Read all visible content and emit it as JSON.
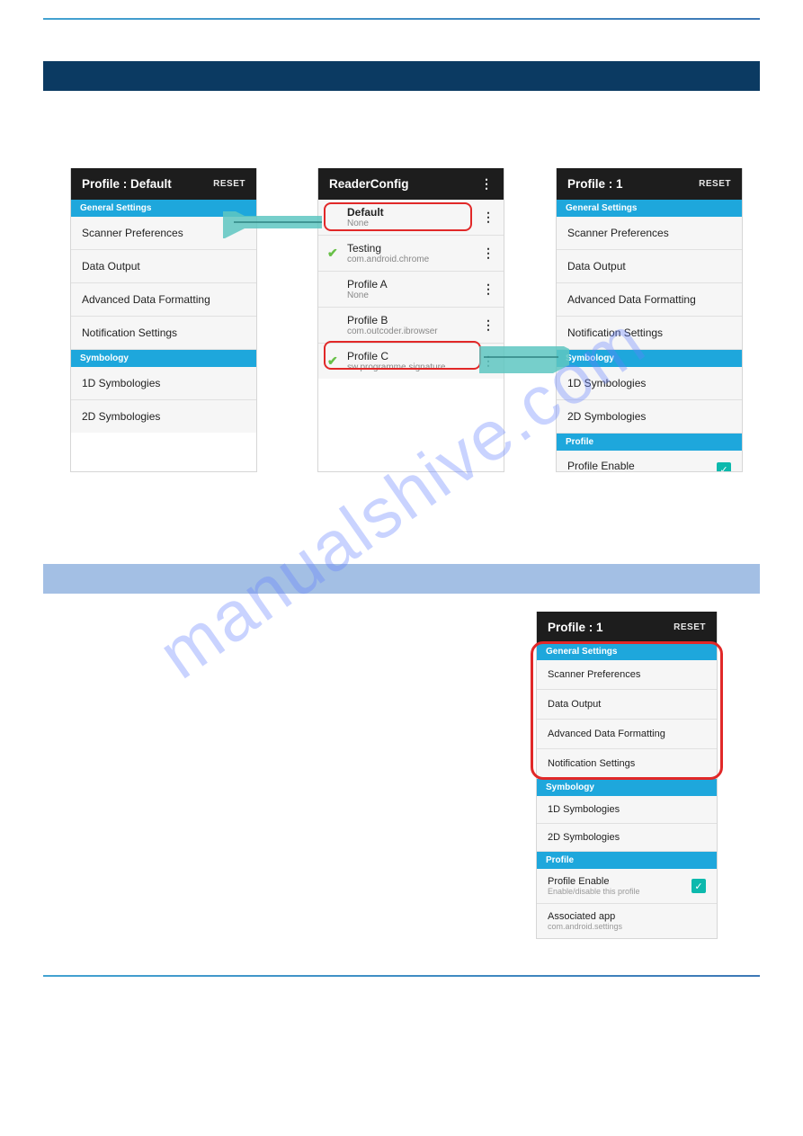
{
  "watermark": "manualshive.com",
  "panel_a": {
    "title": "Profile : Default",
    "reset": "RESET",
    "section1": "General Settings",
    "items1": [
      "Scanner Preferences",
      "Data Output",
      "Advanced Data Formatting",
      "Notification Settings"
    ],
    "section2": "Symbology",
    "items2": [
      "1D Symbologies",
      "2D Symbologies"
    ]
  },
  "panel_b": {
    "title": "ReaderConfig",
    "rows": [
      {
        "title": "Default",
        "sub": "None",
        "bold": true,
        "check": false
      },
      {
        "title": "Testing",
        "sub": "com.android.chrome",
        "bold": false,
        "check": true
      },
      {
        "title": "Profile A",
        "sub": "None",
        "bold": false,
        "check": false
      },
      {
        "title": "Profile B",
        "sub": "com.outcoder.ibrowser",
        "bold": false,
        "check": false
      },
      {
        "title": "Profile C",
        "sub": "sw.programme.signature",
        "bold": false,
        "check": true
      }
    ]
  },
  "panel_c": {
    "title": "Profile : 1",
    "reset": "RESET",
    "section1": "General Settings",
    "items1": [
      "Scanner Preferences",
      "Data Output",
      "Advanced Data Formatting",
      "Notification Settings"
    ],
    "section2": "Symbology",
    "items2": [
      "1D Symbologies",
      "2D Symbologies"
    ],
    "section3": "Profile",
    "items3": [
      "Profile Enable"
    ]
  },
  "panel_d": {
    "title": "Profile : 1",
    "reset": "RESET",
    "section1": "General Settings",
    "items1": [
      "Scanner Preferences",
      "Data Output",
      "Advanced Data Formatting",
      "Notification Settings"
    ],
    "section2": "Symbology",
    "items2": [
      "1D Symbologies",
      "2D Symbologies"
    ],
    "section3": "Profile",
    "profile_enable_title": "Profile Enable",
    "profile_enable_sub": "Enable/disable this profile",
    "assoc_title": "Associated app",
    "assoc_sub": "com.android.settings"
  }
}
